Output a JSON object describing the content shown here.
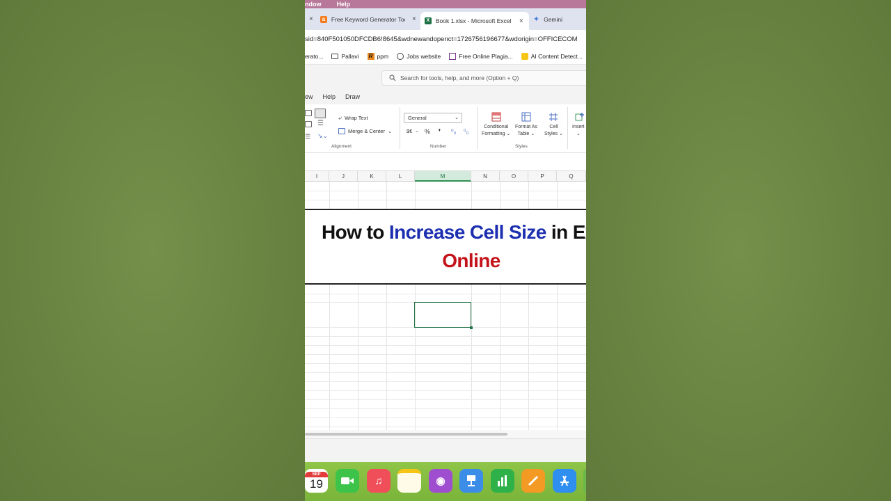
{
  "menubar": {
    "items": [
      "ndow",
      "Help"
    ]
  },
  "tabs": [
    {
      "title": "Free Keyword Generator Tool",
      "close": "×",
      "icon": "ahrefs-icon",
      "color": "#f57c1f"
    },
    {
      "title": "Book 1.xlsx - Microsoft Excel",
      "close": "×",
      "icon": "excel-icon",
      "color": "#1e7145",
      "active": true
    },
    {
      "title": "Gemini",
      "icon": "gemini-icon",
      "color": "#4a7bd8"
    }
  ],
  "leading_close": "×",
  "address": "sid=840F501050DFCDB6!8645&wdnewandopenct=1726756196677&wdorigin=OFFICECOM",
  "bookmarks": [
    {
      "label": "erato...",
      "icon": "none"
    },
    {
      "label": "Pallavi",
      "icon": "folder-icon"
    },
    {
      "label": "ppm",
      "icon": "r-logo-icon"
    },
    {
      "label": "Jobs website",
      "icon": "globe-icon"
    },
    {
      "label": "Free Online Plagia...",
      "icon": "doc-icon"
    },
    {
      "label": "AI Content Detect...",
      "icon": "ai-detect-icon"
    }
  ],
  "search": {
    "placeholder": "Search for tools, help, and more (Option + Q)"
  },
  "menu": [
    "ew",
    "Help",
    "Draw"
  ],
  "ribbon": {
    "wrap_text": "Wrap Text",
    "merge_center": "Merge & Center",
    "alignment_label": "Alignment",
    "number_format": "General",
    "currency": "$€",
    "percent": "%",
    "comma": "❜",
    "number_label": "Number",
    "conditional_1": "Conditional",
    "conditional_2": "Formatting",
    "format_table_1": "Format As",
    "format_table_2": "Table",
    "cell_styles_1": "Cell",
    "cell_styles_2": "Styles",
    "styles_label": "Styles",
    "insert": "Insert"
  },
  "columns": [
    "I",
    "J",
    "K",
    "L",
    "M",
    "N",
    "O",
    "P",
    "Q"
  ],
  "selected_column": "M",
  "overlay": {
    "line1_a": "How to ",
    "line1_b": "Increase Cell Size",
    "line1_c": " in Ex",
    "line2": "Online"
  },
  "dock": {
    "calendar_month": "SEP",
    "calendar_day": "19"
  },
  "colors": {
    "accent": "#217346",
    "title_blue": "#1c2fb0",
    "title_red": "#c4141b",
    "background": "#6a8444"
  }
}
